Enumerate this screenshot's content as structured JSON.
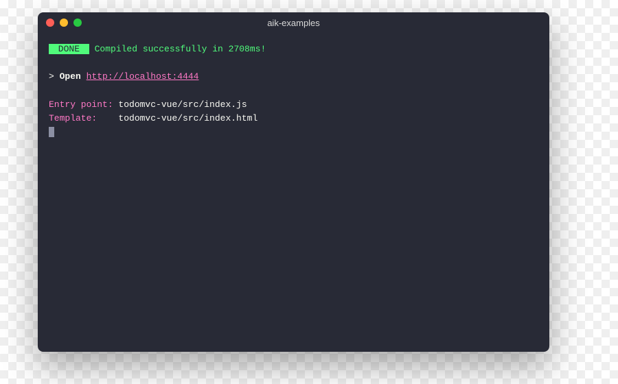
{
  "window": {
    "title": "aik-examples"
  },
  "output": {
    "done_badge": " DONE ",
    "compiled_msg": " Compiled successfully in 2708ms!",
    "prompt": ">",
    "open_label": "Open",
    "open_url": "http://localhost:4444",
    "entry_label": "Entry point:",
    "entry_value": " todomvc-vue/src/index.js",
    "template_label": "Template:   ",
    "template_value": " todomvc-vue/src/index.html"
  },
  "colors": {
    "bg": "#282a36",
    "green": "#50fa7b",
    "pink": "#ff79c6",
    "fg": "#f8f8f2"
  }
}
